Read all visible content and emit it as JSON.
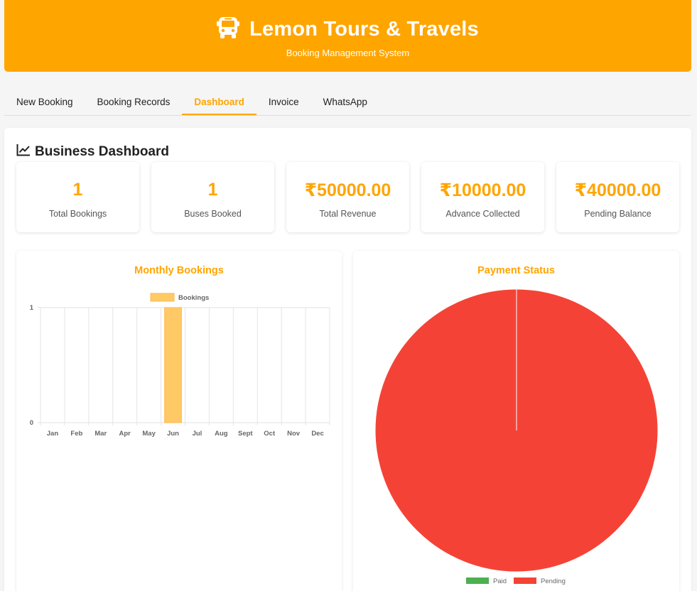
{
  "header": {
    "title": "Lemon Tours & Travels",
    "subtitle": "Booking Management System",
    "icon": "bus-icon",
    "color": "#FFA500"
  },
  "tabs": [
    {
      "label": "New Booking",
      "active": false
    },
    {
      "label": "Booking Records",
      "active": false
    },
    {
      "label": "Dashboard",
      "active": true
    },
    {
      "label": "Invoice",
      "active": false
    },
    {
      "label": "WhatsApp",
      "active": false
    }
  ],
  "dashboard": {
    "title": "Business Dashboard",
    "icon": "chart-line-icon",
    "stats": [
      {
        "value": "1",
        "label": "Total Bookings"
      },
      {
        "value": "1",
        "label": "Buses Booked"
      },
      {
        "value": "₹50000.00",
        "label": "Total Revenue"
      },
      {
        "value": "₹10000.00",
        "label": "Advance Collected"
      },
      {
        "value": "₹40000.00",
        "label": "Pending Balance"
      }
    ]
  },
  "chart_data": [
    {
      "type": "bar",
      "title": "Monthly Bookings",
      "categories": [
        "Jan",
        "Feb",
        "Mar",
        "Apr",
        "May",
        "Jun",
        "Jul",
        "Aug",
        "Sept",
        "Oct",
        "Nov",
        "Dec"
      ],
      "series": [
        {
          "name": "Bookings",
          "values": [
            0,
            0,
            0,
            0,
            0,
            1,
            0,
            0,
            0,
            0,
            0,
            0
          ],
          "color": "#FFC966"
        }
      ],
      "ylim": [
        0,
        1
      ],
      "yticks": [
        "0",
        "1"
      ],
      "legend": "top",
      "grid": true
    },
    {
      "type": "pie",
      "title": "Payment Status",
      "labels": [
        "Paid",
        "Pending"
      ],
      "values": [
        0,
        1
      ],
      "colors": [
        "#4CAF50",
        "#F44336"
      ],
      "legend": "bottom"
    }
  ]
}
